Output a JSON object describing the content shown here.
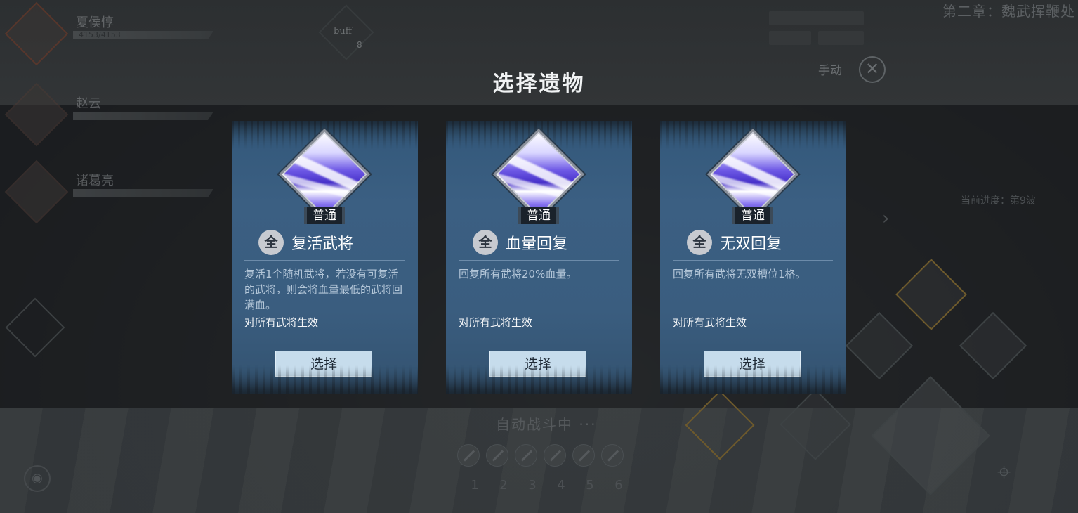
{
  "header": {
    "chapter": "第二章：魏武挥鞭处",
    "manual_label": "手动",
    "manual_icon": "crossed-swords-icon"
  },
  "heroes": [
    {
      "name": "夏侯惇",
      "hp": "4153/4153"
    },
    {
      "name": "赵云",
      "hp": ""
    },
    {
      "name": "诸葛亮",
      "hp": ""
    }
  ],
  "buff": {
    "label": "buff",
    "count": "8"
  },
  "stage_progress": "当前进度：第9波",
  "battle": {
    "auto_label": "自动战斗中 ···",
    "slots": [
      "1",
      "2",
      "3",
      "4",
      "5",
      "6"
    ],
    "attack_label": "攻"
  },
  "modal": {
    "title": "选择遗物",
    "cards": [
      {
        "rarity": "普通",
        "scope": "全",
        "name": "复活武将",
        "description": "复活1个随机武将，若没有可复活的武将，则会将血量最低的武将回满血。",
        "effect": "对所有武将生效",
        "button": "选择",
        "icon": "relic-wing-icon"
      },
      {
        "rarity": "普通",
        "scope": "全",
        "name": "血量回复",
        "description": "回复所有武将20%血量。",
        "effect": "对所有武将生效",
        "button": "选择",
        "icon": "relic-wing-icon"
      },
      {
        "rarity": "普通",
        "scope": "全",
        "name": "无双回复",
        "description": "回复所有武将无双槽位1格。",
        "effect": "对所有武将生效",
        "button": "选择",
        "icon": "relic-wing-icon"
      }
    ]
  },
  "colors": {
    "card_bg": "#3a5d7f",
    "button_bg": "#c6dcec",
    "rarity_bg": "#1a222b",
    "relic_purple": "#4630c9"
  }
}
